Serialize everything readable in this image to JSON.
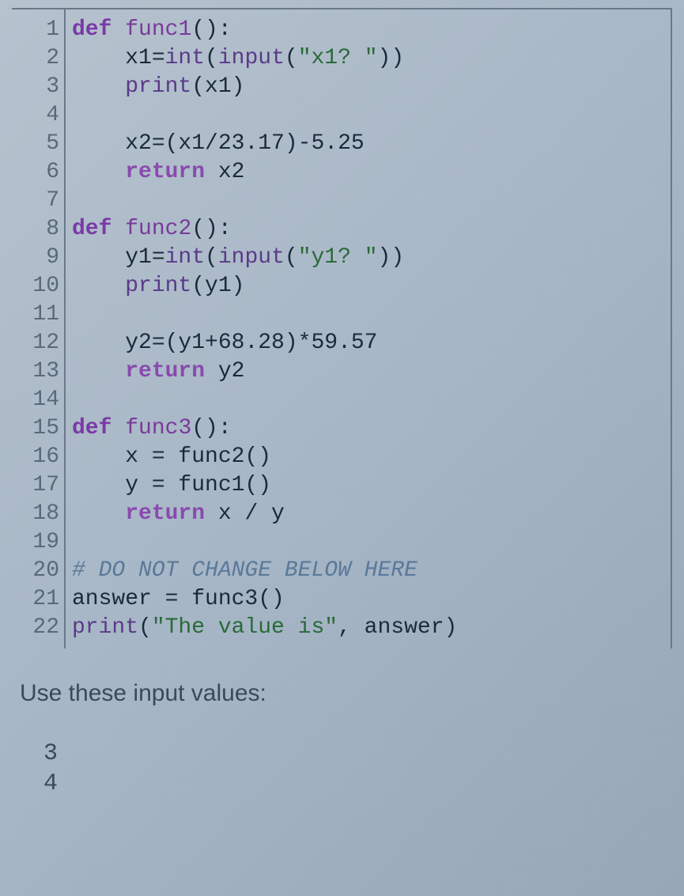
{
  "editor": {
    "lines": [
      {
        "num": "1",
        "tokens": [
          {
            "cls": "kw",
            "t": "def"
          },
          {
            "cls": "",
            "t": " "
          },
          {
            "cls": "fn",
            "t": "func1"
          },
          {
            "cls": "",
            "t": "():"
          }
        ]
      },
      {
        "num": "2",
        "tokens": [
          {
            "cls": "",
            "t": "    x1="
          },
          {
            "cls": "bi",
            "t": "int"
          },
          {
            "cls": "",
            "t": "("
          },
          {
            "cls": "bi",
            "t": "input"
          },
          {
            "cls": "",
            "t": "("
          },
          {
            "cls": "str",
            "t": "\"x1? \""
          },
          {
            "cls": "",
            "t": "))"
          }
        ]
      },
      {
        "num": "3",
        "tokens": [
          {
            "cls": "",
            "t": "    "
          },
          {
            "cls": "bi",
            "t": "print"
          },
          {
            "cls": "",
            "t": "(x1)"
          }
        ]
      },
      {
        "num": "4",
        "tokens": []
      },
      {
        "num": "5",
        "tokens": [
          {
            "cls": "",
            "t": "    x2=(x1/"
          },
          {
            "cls": "num",
            "t": "23.17"
          },
          {
            "cls": "",
            "t": ")-"
          },
          {
            "cls": "num",
            "t": "5.25"
          }
        ]
      },
      {
        "num": "6",
        "tokens": [
          {
            "cls": "",
            "t": "    "
          },
          {
            "cls": "ret",
            "t": "return"
          },
          {
            "cls": "",
            "t": " x2"
          }
        ]
      },
      {
        "num": "7",
        "tokens": []
      },
      {
        "num": "8",
        "tokens": [
          {
            "cls": "kw",
            "t": "def"
          },
          {
            "cls": "",
            "t": " "
          },
          {
            "cls": "fn",
            "t": "func2"
          },
          {
            "cls": "",
            "t": "():"
          }
        ]
      },
      {
        "num": "9",
        "tokens": [
          {
            "cls": "",
            "t": "    y1="
          },
          {
            "cls": "bi",
            "t": "int"
          },
          {
            "cls": "",
            "t": "("
          },
          {
            "cls": "bi",
            "t": "input"
          },
          {
            "cls": "",
            "t": "("
          },
          {
            "cls": "str",
            "t": "\"y1? \""
          },
          {
            "cls": "",
            "t": "))"
          }
        ]
      },
      {
        "num": "10",
        "tokens": [
          {
            "cls": "",
            "t": "    "
          },
          {
            "cls": "bi",
            "t": "print"
          },
          {
            "cls": "",
            "t": "(y1)"
          }
        ]
      },
      {
        "num": "11",
        "tokens": []
      },
      {
        "num": "12",
        "tokens": [
          {
            "cls": "",
            "t": "    y2=(y1+"
          },
          {
            "cls": "num",
            "t": "68.28"
          },
          {
            "cls": "",
            "t": ")*"
          },
          {
            "cls": "num",
            "t": "59.57"
          }
        ]
      },
      {
        "num": "13",
        "tokens": [
          {
            "cls": "",
            "t": "    "
          },
          {
            "cls": "ret",
            "t": "return"
          },
          {
            "cls": "",
            "t": " y2"
          }
        ]
      },
      {
        "num": "14",
        "tokens": []
      },
      {
        "num": "15",
        "tokens": [
          {
            "cls": "kw",
            "t": "def"
          },
          {
            "cls": "",
            "t": " "
          },
          {
            "cls": "fn",
            "t": "func3"
          },
          {
            "cls": "",
            "t": "():"
          }
        ]
      },
      {
        "num": "16",
        "tokens": [
          {
            "cls": "",
            "t": "    x = func2()"
          }
        ]
      },
      {
        "num": "17",
        "tokens": [
          {
            "cls": "",
            "t": "    y = func1()"
          }
        ]
      },
      {
        "num": "18",
        "tokens": [
          {
            "cls": "",
            "t": "    "
          },
          {
            "cls": "ret",
            "t": "return"
          },
          {
            "cls": "",
            "t": " x / y"
          }
        ]
      },
      {
        "num": "19",
        "tokens": []
      },
      {
        "num": "20",
        "tokens": [
          {
            "cls": "cmt",
            "t": "# DO NOT CHANGE BELOW HERE"
          }
        ]
      },
      {
        "num": "21",
        "tokens": [
          {
            "cls": "",
            "t": "answer = func3()"
          }
        ]
      },
      {
        "num": "22",
        "tokens": [
          {
            "cls": "bi",
            "t": "print"
          },
          {
            "cls": "",
            "t": "("
          },
          {
            "cls": "str",
            "t": "\"The value is\""
          },
          {
            "cls": "",
            "t": ", answer)"
          }
        ]
      }
    ]
  },
  "prompt": "Use these input values:",
  "inputs": [
    "3",
    "4"
  ]
}
